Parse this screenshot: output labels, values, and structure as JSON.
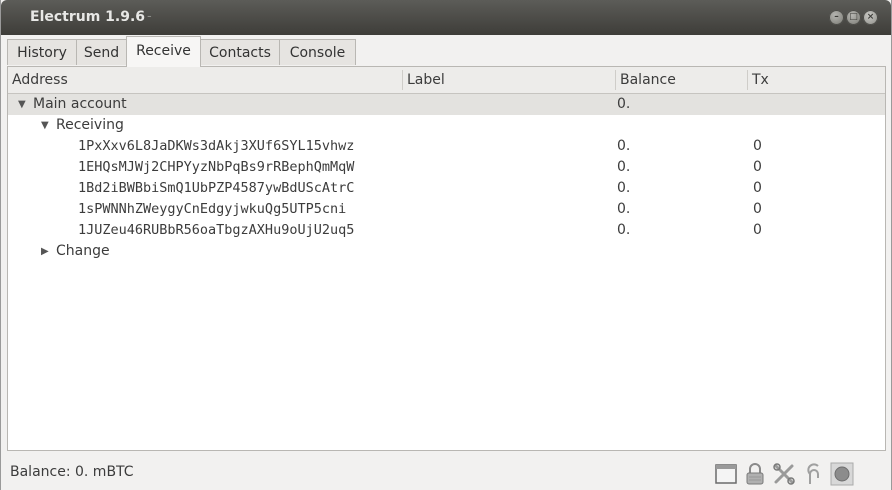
{
  "window": {
    "title": "Electrum 1.9.6",
    "title_suffix": "-"
  },
  "tabs": [
    {
      "label": "History",
      "active": false
    },
    {
      "label": "Send",
      "active": false
    },
    {
      "label": "Receive",
      "active": true
    },
    {
      "label": "Contacts",
      "active": false
    },
    {
      "label": "Console",
      "active": false
    }
  ],
  "table": {
    "columns": [
      "Address",
      "Label",
      "Balance",
      "Tx"
    ],
    "account": {
      "name": "Main account",
      "balance": "0.",
      "expanded": true
    },
    "receiving": {
      "label": "Receiving",
      "expanded": true,
      "rows": [
        {
          "address": "1PxXxv6L8JaDKWs3dAkj3XUf6SYL15vhwz",
          "label": "",
          "balance": "0.",
          "tx": "0"
        },
        {
          "address": "1EHQsMJWj2CHPYyzNbPqBs9rRBephQmMqW",
          "label": "",
          "balance": "0.",
          "tx": "0"
        },
        {
          "address": "1Bd2iBWBbiSmQ1UbPZP4587ywBdUScAtrC",
          "label": "",
          "balance": "0.",
          "tx": "0"
        },
        {
          "address": "1sPWNNhZWeygyCnEdgyjwkuQg5UTP5cni",
          "label": "",
          "balance": "0.",
          "tx": "0"
        },
        {
          "address": "1JUZeu46RUBbR56oaTbgzAXHu9oUjU2uq5",
          "label": "",
          "balance": "0.",
          "tx": "0"
        }
      ]
    },
    "change": {
      "label": "Change",
      "expanded": false
    }
  },
  "statusbar": {
    "balance_text": "Balance: 0. mBTC",
    "icons": [
      "window-icon",
      "lock-icon",
      "tools-icon",
      "seed-icon",
      "network-status-icon"
    ]
  },
  "colors": {
    "titlebar": "#3e3d39",
    "title_text": "#e8e8e6",
    "selected_row": "#e3e2df",
    "window_bg": "#f2f1f0"
  }
}
